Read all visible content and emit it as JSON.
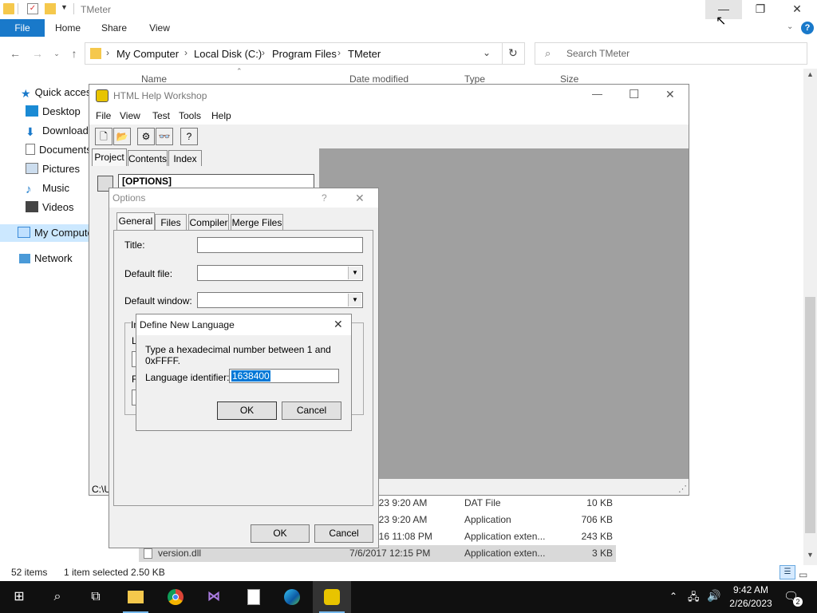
{
  "explorer": {
    "window_title": "TMeter",
    "ribbon_tabs": [
      "File",
      "Home",
      "Share",
      "View"
    ],
    "breadcrumbs": [
      "My Computer",
      "Local Disk (C:)",
      "Program Files",
      "TMeter"
    ],
    "search_placeholder": "Search TMeter",
    "columns": [
      "Name",
      "Date modified",
      "Type",
      "Size"
    ],
    "nav_items": [
      {
        "label": "Quick access",
        "icon": "star-icon"
      },
      {
        "label": "Desktop",
        "icon": "desktop-icon"
      },
      {
        "label": "Downloads",
        "icon": "download-icon"
      },
      {
        "label": "Documents",
        "icon": "documents-icon"
      },
      {
        "label": "Pictures",
        "icon": "pictures-icon"
      },
      {
        "label": "Music",
        "icon": "music-icon"
      },
      {
        "label": "Videos",
        "icon": "videos-icon"
      },
      {
        "label": "My Computer",
        "icon": "computer-icon"
      },
      {
        "label": "Network",
        "icon": "network-icon"
      }
    ],
    "files": [
      {
        "name": "",
        "date": "023 9:20 AM",
        "type": "DAT File",
        "size": "10 KB"
      },
      {
        "name": "",
        "date": "023 9:20 AM",
        "type": "Application",
        "size": "706 KB"
      },
      {
        "name": "",
        "date": "016 11:08 PM",
        "type": "Application exten...",
        "size": "243 KB"
      },
      {
        "name": "version.dll",
        "date": "7/6/2017 12:15 PM",
        "type": "Application exten...",
        "size": "3 KB"
      }
    ],
    "status": {
      "items": "52 items",
      "selected": "1 item selected  2.50 KB"
    }
  },
  "hhw": {
    "title": "HTML Help Workshop",
    "menu": [
      "File",
      "View",
      "Test",
      "Tools",
      "Help"
    ],
    "tabs": [
      "Project",
      "Contents",
      "Index"
    ],
    "project_header": "[OPTIONS]",
    "status_path": "C:\\U"
  },
  "options": {
    "title": "Options",
    "help": "?",
    "tabs": [
      "General",
      "Files",
      "Compiler",
      "Merge Files"
    ],
    "labels": {
      "title": "Title:",
      "default_file": "Default file:",
      "default_window": "Default window:"
    },
    "values": {
      "title": "",
      "default_file": "",
      "default_window": ""
    },
    "partial_letters": [
      "In",
      "L",
      "F"
    ],
    "ok": "OK",
    "cancel": "Cancel"
  },
  "define_language": {
    "title": "Define New Language",
    "instructions": "Type a hexadecimal number between 1 and 0xFFFF.",
    "label": "Language identifier:",
    "value": "1638400",
    "ok": "OK",
    "cancel": "Cancel"
  },
  "taskbar": {
    "time": "9:42 AM",
    "date": "2/26/2023",
    "notification_count": "2"
  },
  "colors": {
    "accent": "#1979ca",
    "selection": "#0078d7",
    "taskbar": "#101010",
    "workspace_gray": "#a0a0a0"
  }
}
